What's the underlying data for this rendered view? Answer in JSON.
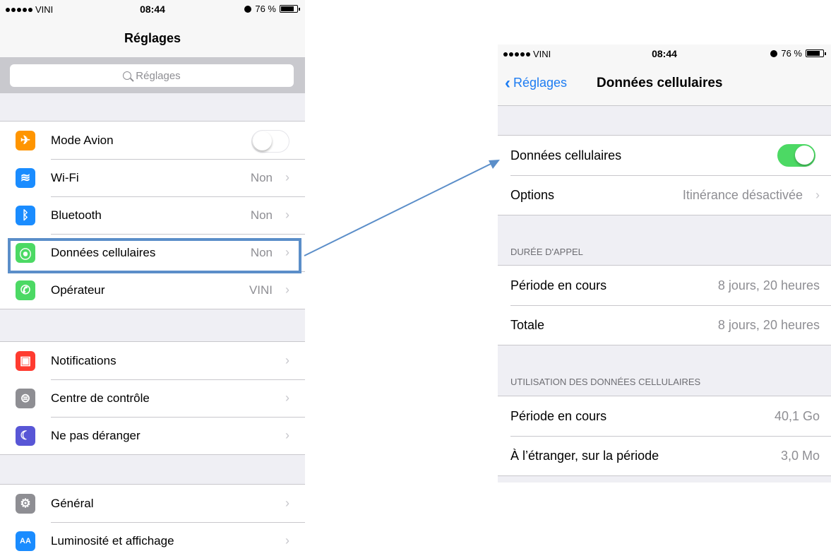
{
  "left": {
    "status": {
      "carrier": "VINI",
      "time": "08:44",
      "battery": "76 %"
    },
    "title": "Réglages",
    "search_placeholder": "Réglages",
    "groups": [
      [
        {
          "label": "Mode Avion",
          "icon": "airplane-icon",
          "color": "#ff9500",
          "toggle": "off"
        },
        {
          "label": "Wi-Fi",
          "icon": "wifi-icon",
          "color": "#1a8cff",
          "value": "Non"
        },
        {
          "label": "Bluetooth",
          "icon": "bluetooth-icon",
          "color": "#1a8cff",
          "value": "Non"
        },
        {
          "label": "Données cellulaires",
          "icon": "cellular-icon",
          "color": "#4cd964",
          "value": "Non",
          "highlighted": true
        },
        {
          "label": "Opérateur",
          "icon": "phone-icon",
          "color": "#4cd964",
          "value": "VINI"
        }
      ],
      [
        {
          "label": "Notifications",
          "icon": "notifications-icon",
          "color": "#ff3b30"
        },
        {
          "label": "Centre de contrôle",
          "icon": "control-center-icon",
          "color": "#8e8e93"
        },
        {
          "label": "Ne pas déranger",
          "icon": "moon-icon",
          "color": "#5856d6"
        }
      ],
      [
        {
          "label": "Général",
          "icon": "gear-icon",
          "color": "#8e8e93"
        },
        {
          "label": "Luminosité et affichage",
          "icon": "display-icon",
          "color": "#1a8cff"
        }
      ]
    ]
  },
  "right": {
    "status": {
      "carrier": "VINI",
      "time": "08:44",
      "battery": "76 %"
    },
    "back_label": "Réglages",
    "title": "Données cellulaires",
    "cellular": {
      "label": "Données cellulaires",
      "toggle": "on"
    },
    "options": {
      "label": "Options",
      "value": "Itinérance désactivée"
    },
    "call_header": "DURÉE D'APPEL",
    "call_rows": [
      {
        "label": "Période en cours",
        "value": "8 jours, 20 heures"
      },
      {
        "label": "Totale",
        "value": "8 jours, 20 heures"
      }
    ],
    "data_header": "UTILISATION DES DONNÉES CELLULAIRES",
    "data_rows": [
      {
        "label": "Période en cours",
        "value": "40,1 Go"
      },
      {
        "label": "À l’étranger, sur la période",
        "value": "3,0 Mo"
      }
    ]
  },
  "colors": {
    "accent": "#1d7cf2",
    "toggle_on": "#4cd964",
    "highlight": "#5b8ec9",
    "arrow": "#5b8ec9"
  }
}
